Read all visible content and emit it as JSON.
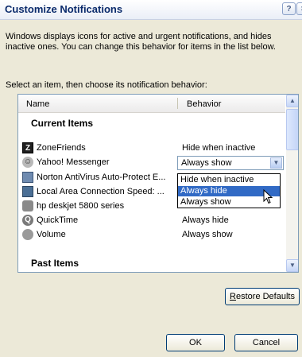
{
  "dialog": {
    "title": "Customize Notifications",
    "help_icon": "question-mark",
    "close_icon": "x-mark"
  },
  "intro": {
    "text": "Windows displays icons for active and urgent notifications, and hides inactive ones. You can change this behavior for items in the list below.",
    "select_label": "Select an item, then choose its notification behavior:"
  },
  "list": {
    "columns": [
      "Name",
      "Behavior"
    ],
    "current_section": "Current Items",
    "past_section": "Past Items",
    "items": [
      {
        "name": "ZoneFriends",
        "behavior": "Hide when inactive",
        "icon": "zone-icon"
      },
      {
        "name": "Yahoo! Messenger",
        "behavior": "Always show",
        "icon": "smiley-icon"
      },
      {
        "name": "Norton AntiVirus Auto-Protect E...",
        "behavior": "",
        "icon": "shield-icon"
      },
      {
        "name": "Local Area Connection Speed: ...",
        "behavior": "",
        "icon": "network-icon"
      },
      {
        "name": "hp deskjet 5800 series",
        "behavior": "Hide when inactive",
        "icon": "printer-icon"
      },
      {
        "name": "QuickTime",
        "behavior": "Always hide",
        "icon": "quicktime-icon"
      },
      {
        "name": "Volume",
        "behavior": "Always show",
        "icon": "speaker-icon"
      }
    ]
  },
  "combo": {
    "value": "Always show",
    "options": [
      "Hide when inactive",
      "Always hide",
      "Always show"
    ],
    "highlighted": "Always hide"
  },
  "buttons": {
    "restore_prefix": "R",
    "restore_rest": "estore Defaults",
    "ok": "OK",
    "cancel": "Cancel"
  },
  "colors": {
    "selection": "#316ac5",
    "title_text": "#0a2a6b"
  }
}
